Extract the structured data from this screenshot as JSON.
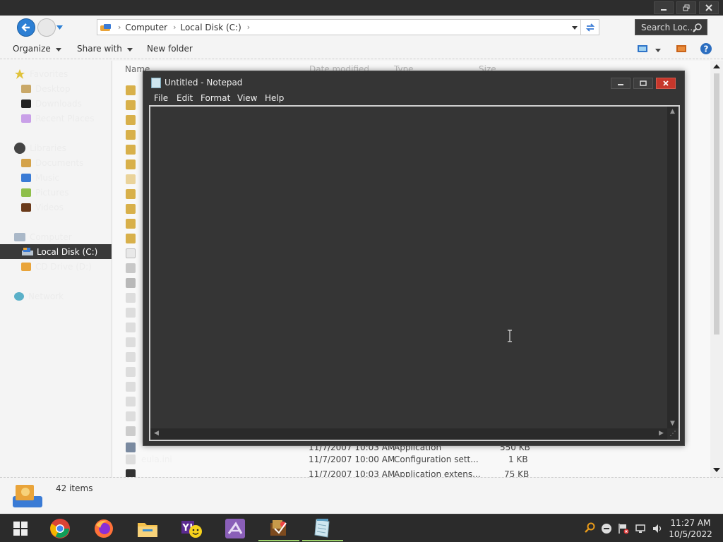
{
  "explorer": {
    "address": {
      "segments": [
        "Computer",
        "Local Disk (C:)"
      ]
    },
    "search_placeholder": "Search Loc...",
    "toolbar": {
      "organize": "Organize",
      "share_with": "Share with",
      "new_folder": "New folder"
    },
    "nav": {
      "items": [
        {
          "label": "Favorites"
        },
        {
          "label": "Desktop"
        },
        {
          "label": "Downloads"
        },
        {
          "label": "Recent Places"
        },
        {
          "label": "Libraries"
        },
        {
          "label": "Documents"
        },
        {
          "label": "Music"
        },
        {
          "label": "Pictures"
        },
        {
          "label": "Videos"
        },
        {
          "label": "Computer"
        },
        {
          "label": "Local Disk (C:)"
        },
        {
          "label": "CD Drive (D:)"
        },
        {
          "label": "Network"
        }
      ]
    },
    "columns": {
      "name": "Name",
      "date": "Date modified",
      "type": "Type",
      "size": "Size"
    },
    "rows": [
      {
        "name": "",
        "date": "11/7/2007 10:03 AM",
        "type": "Application",
        "size": "550 KB"
      },
      {
        "name": "eula.ini",
        "date": "11/7/2007 10:00 AM",
        "type": "Configuration sett...",
        "size": "1 KB"
      },
      {
        "name": "",
        "date": "11/7/2007 10:03 AM",
        "type": "Application extens...",
        "size": "75 KB"
      }
    ],
    "status": {
      "count": "42 items"
    }
  },
  "notepad": {
    "title": "Untitled - Notepad",
    "menu": [
      "File",
      "Edit",
      "Format",
      "View",
      "Help"
    ],
    "content": ""
  },
  "taskbar": {
    "clock_time": "11:27 AM",
    "clock_date": "10/5/2022"
  },
  "colors": {
    "notepad_bg": "#353535",
    "close_red": "#c6372b",
    "selection": "#3a3a3a"
  }
}
